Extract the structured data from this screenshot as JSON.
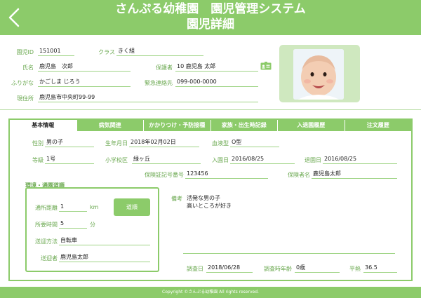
{
  "header": {
    "title_line1": "さんぷる幼稚園　園児管理システム",
    "title_line2": "園児詳細"
  },
  "profile": {
    "id_label": "園児ID",
    "id_value": "151001",
    "class_label": "クラス",
    "class_value": "きく組",
    "name_label": "氏名",
    "name_value": "鹿児島　次郎",
    "guardian_label": "保護者",
    "guardian_value": "10 鹿児島 太郎",
    "kana_label": "ふりがな",
    "kana_value": "かごしま じろう",
    "emergency_label": "緊急連絡先",
    "emergency_value": "099-000-0000",
    "address_label": "現住所",
    "address_value": "鹿児島市中央町99-99"
  },
  "tabs": [
    {
      "label": "基本情報",
      "active": true
    },
    {
      "label": "病気関連",
      "active": false
    },
    {
      "label": "かかりつけ・予防接種",
      "active": false
    },
    {
      "label": "家族・出生時記録",
      "active": false
    },
    {
      "label": "入退園履歴",
      "active": false
    },
    {
      "label": "注文履歴",
      "active": false
    }
  ],
  "basic": {
    "gender_label": "性別",
    "gender_value": "男の子",
    "birth_label": "生年月日",
    "birth_value": "2018年02月02日",
    "blood_label": "血液型",
    "blood_value": "O型",
    "grade_label": "等級",
    "grade_value": "1号",
    "school_label": "小学校区",
    "school_value": "緑ヶ丘",
    "enroll_label": "入園日",
    "enroll_value": "2016/08/25",
    "leave_label": "退園日",
    "leave_value": "2016/08/25",
    "insurance_label": "保険証記号番号",
    "insurance_value": "123456",
    "insured_label": "保険者名",
    "insured_value": "鹿児島太郎"
  },
  "commute": {
    "section_title": "環境・通園道順",
    "distance_label": "通所距離",
    "distance_value": "1",
    "distance_unit": "km",
    "time_label": "所要時間",
    "time_value": "5",
    "time_unit": "分",
    "method_label": "送迎方法",
    "method_value": "自転車",
    "person_label": "送迎者",
    "person_value": "鹿児島太郎",
    "change_button": "道順"
  },
  "remarks": {
    "label": "備考",
    "line1": "活発な男の子",
    "line2": "高いところが好き"
  },
  "survey": {
    "date_label": "調査日",
    "date_value": "2018/06/28",
    "age_label": "調査時年齢",
    "age_value": "0歳",
    "temp_label": "平熱",
    "temp_value": "36.5"
  },
  "footer": {
    "copyright": "Copyright ©さんぷる幼稚園 All rights reserved."
  },
  "colors": {
    "accent": "#8ccb6a",
    "label": "#6aa84f"
  }
}
